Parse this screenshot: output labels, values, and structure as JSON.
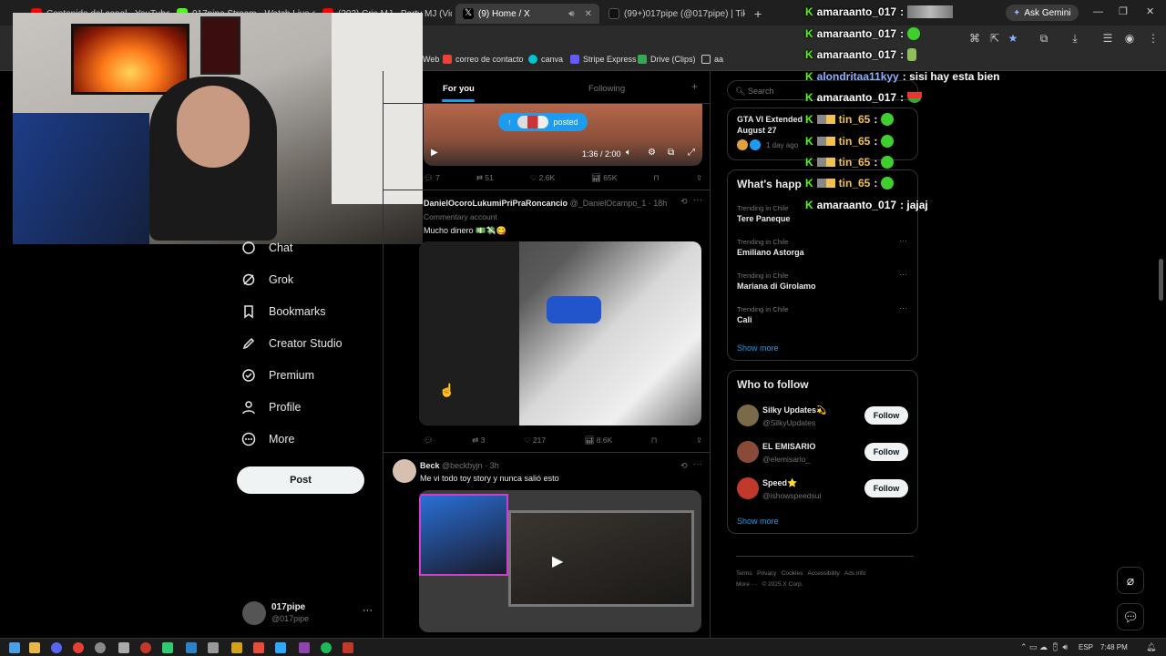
{
  "browser": {
    "tabs": [
      {
        "label": "Contenido del canal - YouTube",
        "color": "#ff0000"
      },
      {
        "label": "017pipe Stream - Watch Live o...",
        "color": "#53fc18"
      },
      {
        "label": "(202) Cris MJ - Party MJ (Video",
        "color": "#ff0000"
      },
      {
        "label": "(9) Home / X",
        "color": "#000000"
      },
      {
        "label": "(99+)017pipe (@017pipe) | Tik",
        "color": "#111111"
      }
    ],
    "ask_gemini": "Ask Gemini",
    "bookmarks": [
      {
        "label": "Web",
        "color": "#888"
      },
      {
        "label": "correo de contacto",
        "color": "#ea4335"
      },
      {
        "label": "canva",
        "color": "#00c4cc"
      },
      {
        "label": "Stripe Express",
        "color": "#635bff"
      },
      {
        "label": "Drive (Clips)",
        "color": "#34a853"
      },
      {
        "label": "aa",
        "color": "#cccccc"
      }
    ]
  },
  "nav": {
    "items": [
      "Chat",
      "Grok",
      "Bookmarks",
      "Creator Studio",
      "Premium",
      "Profile",
      "More"
    ],
    "post": "Post",
    "account_name": "017pipe",
    "account_handle": "@017pipe",
    "account_more": "···"
  },
  "feed": {
    "tabs": [
      "For you",
      "Following"
    ],
    "add_tab": "+",
    "posted_pill": "posted",
    "video_time": "1:36 / 2:00",
    "tweet1_stats": {
      "replies": "7",
      "retweets": "51",
      "likes": "2.6K",
      "views": "65K"
    },
    "tweet2": {
      "name": "DanielOcoroLukumiPriPraRoncancio",
      "handle": "@_DanielOcampo_1",
      "time": "· 18h",
      "tag": "Commentary account",
      "text": "Mucho dinero 💵💸😋",
      "stats": {
        "replies": "",
        "retweets": "3",
        "likes": "217",
        "views": "8.6K"
      }
    },
    "tweet3": {
      "name": "Beck",
      "handle": "@beckbyjn",
      "time": "· 3h",
      "text": "Me vi todo toy story y nunca salió esto"
    }
  },
  "sidebar": {
    "search_placeholder": "Search",
    "live_title": "GTA VI Extended",
    "live_sub": "August 27",
    "live_time": "1 day ago",
    "happening_title": "What's happ",
    "trends": [
      {
        "context": "Trending in Chile",
        "name": "Tere Paneque"
      },
      {
        "context": "Trending in Chile",
        "name": "Emiliano Astorga"
      },
      {
        "context": "Trending in Chile",
        "name": "Mariana di Girolamo"
      },
      {
        "context": "Trending in Chile",
        "name": "Cali"
      }
    ],
    "show_more": "Show more",
    "who_to_follow_title": "Who to follow",
    "follows": [
      {
        "name": "Silky Updates💫",
        "handle": "@SilkyUpdates",
        "color": "#7b6a4a"
      },
      {
        "name": "EL EMISARIO",
        "handle": "@elemisario_",
        "color": "#8a4a3a"
      },
      {
        "name": "Speed⭐",
        "handle": "@ishowspeedsui",
        "color": "#c0392b"
      }
    ],
    "follow_label": "Follow",
    "show_more_2": "Show more",
    "footer": [
      "Terms",
      "Privacy",
      "Cookies",
      "Accessibility",
      "Ads info",
      "More ···",
      "© 2025 X Corp."
    ]
  },
  "chat": [
    {
      "user": "amaraanto_017",
      "msg": ":",
      "color": "#ffffff",
      "emote": "blur"
    },
    {
      "user": "amaraanto_017",
      "msg": ":",
      "color": "#ffffff",
      "emote": "green"
    },
    {
      "user": "amaraanto_017",
      "msg": ":",
      "color": "#ffffff",
      "emote": "bottle"
    },
    {
      "user": "alondritaa11kyy",
      "msg": ": sisi hay esta bien",
      "color": "#8fb2ff",
      "emote": ""
    },
    {
      "user": "amaraanto_017",
      "msg": ":",
      "color": "#ffffff",
      "emote": "watermelon"
    },
    {
      "user": "tin_65",
      "msg": ":",
      "color": "#f2c14e",
      "emote": "green"
    },
    {
      "user": "tin_65",
      "msg": ":",
      "color": "#f2c14e",
      "emote": "green"
    },
    {
      "user": "tin_65",
      "msg": ":",
      "color": "#f2c14e",
      "emote": "green"
    },
    {
      "user": "tin_65",
      "msg": ":",
      "color": "#f2c14e",
      "emote": "green"
    },
    {
      "user": "amaraanto_017",
      "msg": ": jajaj",
      "color": "#ffffff",
      "emote": ""
    }
  ],
  "taskbar": {
    "lang": "ESP",
    "time": "7:48 PM"
  }
}
